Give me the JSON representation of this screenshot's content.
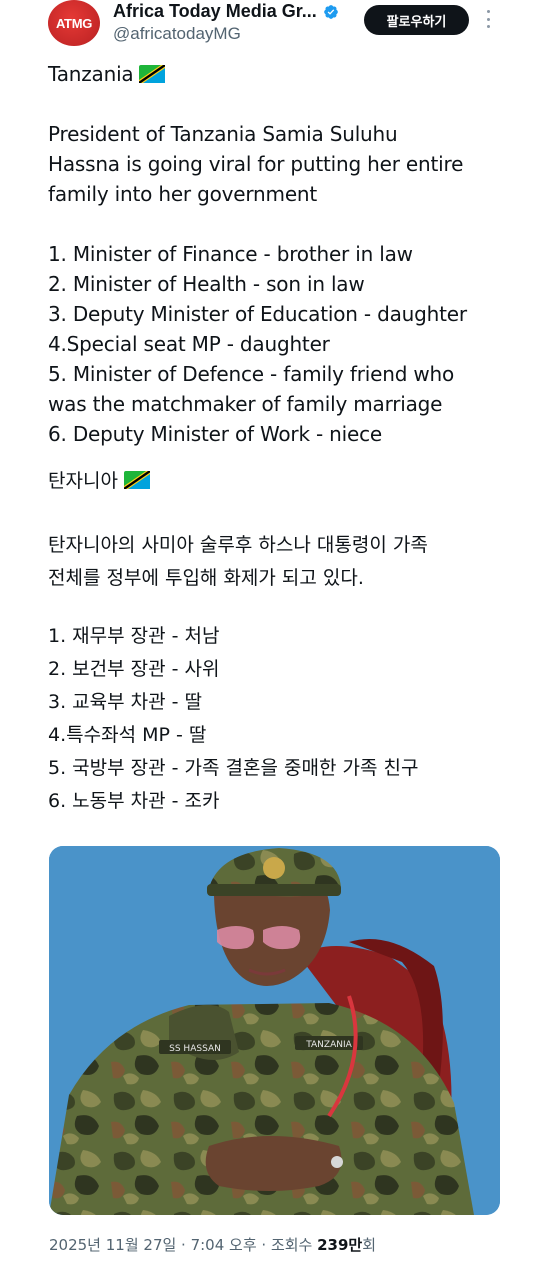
{
  "account": {
    "avatar_text": "ATMG",
    "display_name": "Africa Today Media Gr...",
    "handle": "@africatodayMG",
    "follow_label": "팔로우하기"
  },
  "post": {
    "en_lines": [
      "Tanzania",
      "President of Tanzania Samia Suluhu",
      "Hassna is going viral for putting her entire",
      "family into her government",
      "1. Minister of Finance - brother in law",
      "2. Minister of Health - son in law",
      "3. Deputy Minister of Education - daughter",
      "4.Special seat MP - daughter",
      "5. Minister of Defence - family friend who",
      "was the matchmaker of family marriage",
      "6. Deputy Minister of Work - niece"
    ],
    "ko_lines": [
      "탄자니아",
      "탄자니아의 사미아 술루후 하스나 대통령이 가족",
      "전체를 정부에 투입해 화제가 되고 있다.",
      "1. 재무부 장관 - 처남",
      "2. 보건부 장관 - 사위",
      "3. 교육부 차관 - 딸",
      "4.특수좌석 MP - 딸",
      "5. 국방부 장관 - 가족 결혼을 중매한 가족 친구",
      "6. 노동부 차관 - 조카"
    ],
    "photo_name_tag": "SS HASSAN",
    "photo_country_tag": "TANZANIA"
  },
  "meta": {
    "date_time": "2025년 11월 27일 · 7:04 오후 · 조회수 ",
    "views": "239만",
    "views_suffix": "회"
  },
  "colors": {
    "photo_bg": "#4a93c9",
    "follow_bg": "#0f1419",
    "verified": "#1d9bf0",
    "avatar": "#d32f2f"
  }
}
